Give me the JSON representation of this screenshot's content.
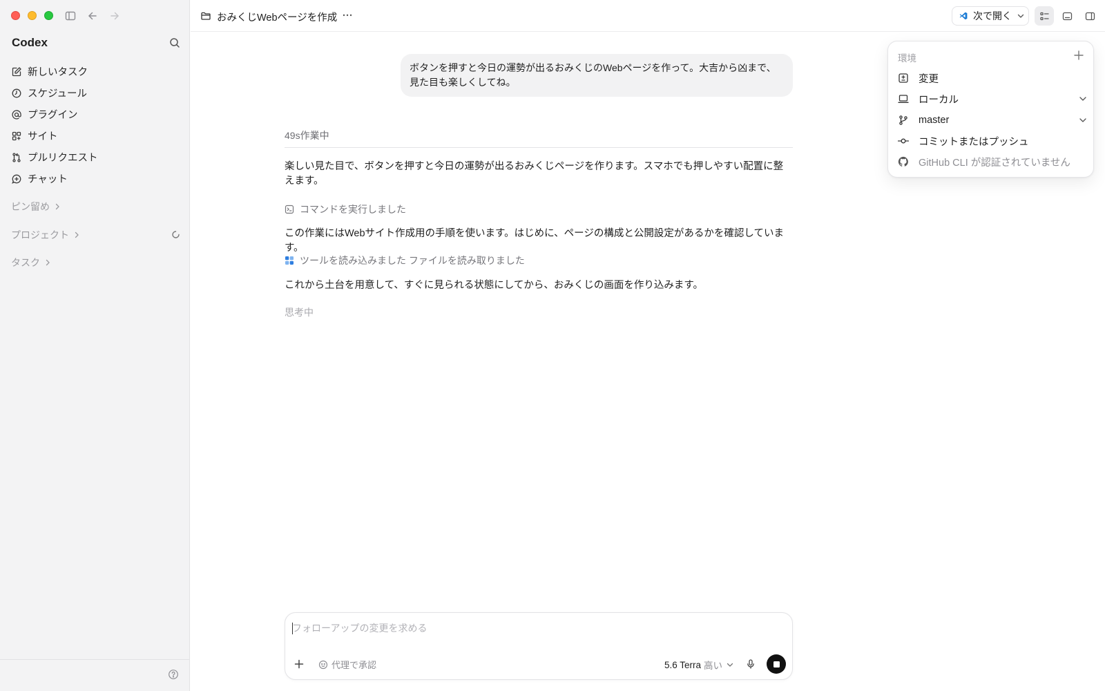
{
  "sidebar": {
    "app_title": "Codex",
    "nav": [
      {
        "label": "新しいタスク",
        "icon": "new-task-icon"
      },
      {
        "label": "スケジュール",
        "icon": "clock-icon"
      },
      {
        "label": "プラグイン",
        "icon": "at-icon"
      },
      {
        "label": "サイト",
        "icon": "grid-icon"
      },
      {
        "label": "プルリクエスト",
        "icon": "pull-request-icon"
      },
      {
        "label": "チャット",
        "icon": "chat-plus-icon"
      }
    ],
    "sections": {
      "pinned": "ピン留め",
      "projects": "プロジェクト",
      "tasks": "タスク"
    }
  },
  "topbar": {
    "title": "おみくじWebページを作成",
    "open_with_label": "次で開く"
  },
  "conversation": {
    "user_message_lines": [
      "ボタンを押すと今日の運勢が出るおみくじのWebページを作って。大吉から凶まで、",
      "見た目も楽しくしてね。"
    ],
    "working_status": "49s作業中",
    "assistant_para_1": "楽しい見た目で、ボタンを押すと今日の運勢が出るおみくじページを作ります。スマホでも押しやすい配置に整えます。",
    "step_command": "コマンドを実行しました",
    "assistant_para_2": "この作業にはWebサイト作成用の手順を使います。はじめに、ページの構成と公開設定があるかを確認しています。",
    "step_tools": "ツールを読み込みました ファイルを読み取りました",
    "assistant_para_3": "これから土台を用意して、すぐに見られる状態にしてから、おみくじの画面を作り込みます。",
    "thinking": "思考中"
  },
  "composer": {
    "placeholder": "フォローアップの変更を求める",
    "approval_label": "代理で承認",
    "model_label": "5.6 Terra",
    "reasoning_level": "高い"
  },
  "env_popover": {
    "heading": "環境",
    "items": [
      {
        "label": "変更",
        "icon": "diff-icon"
      },
      {
        "label": "ローカル",
        "icon": "laptop-icon"
      },
      {
        "label": "master",
        "icon": "branch-icon"
      },
      {
        "label": "コミットまたはプッシュ",
        "icon": "commit-icon"
      },
      {
        "label": "GitHub CLI が認証されていません",
        "icon": "github-icon"
      }
    ]
  },
  "colors": {
    "sidebar_bg": "#f3f3f4",
    "bubble_bg": "#f2f2f3",
    "vscode_blue": "#1a7ad4",
    "stop_button": "#111111"
  }
}
